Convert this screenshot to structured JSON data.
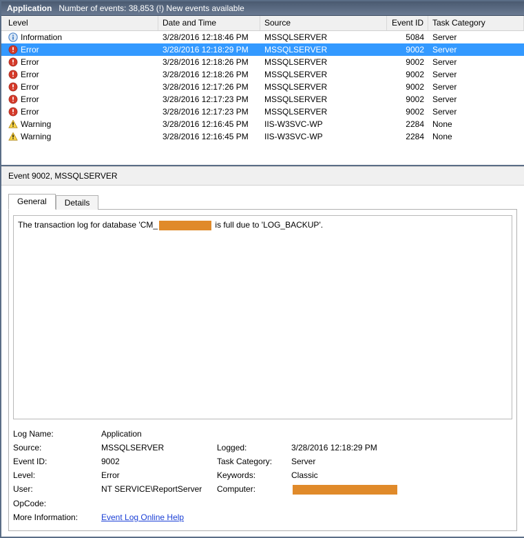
{
  "titlebar": {
    "app": "Application",
    "counts": "Number of events: 38,853 (!) New events available"
  },
  "columns": {
    "level": "Level",
    "datetime": "Date and Time",
    "source": "Source",
    "eventid": "Event ID",
    "task": "Task Category"
  },
  "rows": [
    {
      "icon": "info",
      "level": "Information",
      "dt": "3/28/2016 12:18:46 PM",
      "src": "MSSQLSERVER",
      "eid": "5084",
      "task": "Server",
      "sel": false
    },
    {
      "icon": "error",
      "level": "Error",
      "dt": "3/28/2016 12:18:29 PM",
      "src": "MSSQLSERVER",
      "eid": "9002",
      "task": "Server",
      "sel": true
    },
    {
      "icon": "error",
      "level": "Error",
      "dt": "3/28/2016 12:18:26 PM",
      "src": "MSSQLSERVER",
      "eid": "9002",
      "task": "Server",
      "sel": false
    },
    {
      "icon": "error",
      "level": "Error",
      "dt": "3/28/2016 12:18:26 PM",
      "src": "MSSQLSERVER",
      "eid": "9002",
      "task": "Server",
      "sel": false
    },
    {
      "icon": "error",
      "level": "Error",
      "dt": "3/28/2016 12:17:26 PM",
      "src": "MSSQLSERVER",
      "eid": "9002",
      "task": "Server",
      "sel": false
    },
    {
      "icon": "error",
      "level": "Error",
      "dt": "3/28/2016 12:17:23 PM",
      "src": "MSSQLSERVER",
      "eid": "9002",
      "task": "Server",
      "sel": false
    },
    {
      "icon": "error",
      "level": "Error",
      "dt": "3/28/2016 12:17:23 PM",
      "src": "MSSQLSERVER",
      "eid": "9002",
      "task": "Server",
      "sel": false
    },
    {
      "icon": "warn",
      "level": "Warning",
      "dt": "3/28/2016 12:16:45 PM",
      "src": "IIS-W3SVC-WP",
      "eid": "2284",
      "task": "None",
      "sel": false
    },
    {
      "icon": "warn",
      "level": "Warning",
      "dt": "3/28/2016 12:16:45 PM",
      "src": "IIS-W3SVC-WP",
      "eid": "2284",
      "task": "None",
      "sel": false
    }
  ],
  "detail": {
    "heading": "Event 9002, MSSQLSERVER",
    "tabs": {
      "general": "General",
      "details": "Details"
    },
    "message_pre": "The transaction log for database 'CM_",
    "message_post": " is full due to 'LOG_BACKUP'.",
    "props": {
      "logname_l": "Log Name:",
      "logname_v": "Application",
      "source_l": "Source:",
      "source_v": "MSSQLSERVER",
      "logged_l": "Logged:",
      "logged_v": "3/28/2016 12:18:29 PM",
      "eventid_l": "Event ID:",
      "eventid_v": "9002",
      "taskcat_l": "Task Category:",
      "taskcat_v": "Server",
      "level_l": "Level:",
      "level_v": "Error",
      "keywords_l": "Keywords:",
      "keywords_v": "Classic",
      "user_l": "User:",
      "user_v": "NT SERVICE\\ReportServer",
      "computer_l": "Computer:",
      "opcode_l": "OpCode:",
      "opcode_v": "",
      "moreinfo_l": "More Information:",
      "moreinfo_link": "Event Log Online Help"
    }
  }
}
